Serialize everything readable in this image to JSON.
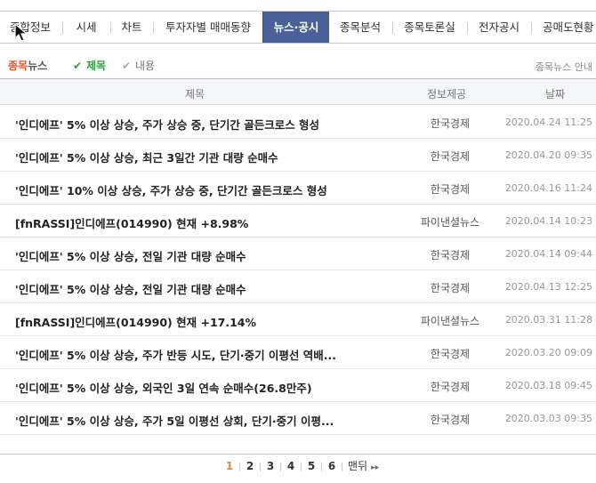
{
  "tabs": [
    {
      "label": "종합정보"
    },
    {
      "label": "시세"
    },
    {
      "label": "차트"
    },
    {
      "label": "투자자별 매매동향"
    },
    {
      "label": "뉴스·공시"
    },
    {
      "label": "종목분석"
    },
    {
      "label": "종목토론실"
    },
    {
      "label": "전자공시"
    },
    {
      "label": "공매도현황"
    }
  ],
  "subnav": {
    "title_a": "종목",
    "title_b": "뉴스",
    "active_label": "제목",
    "inactive_label": "내용",
    "guide": "종목뉴스 안내"
  },
  "table": {
    "headers": {
      "title": "제목",
      "provider": "정보제공",
      "date": "날짜"
    },
    "rows": [
      {
        "title": "'인디에프' 5% 이상 상승, 주가 상승 중, 단기간 골든크로스 형성",
        "provider": "한국경제",
        "date": "2020.04.24 11:25"
      },
      {
        "title": "'인디에프' 5% 이상 상승, 최근 3일간 기관 대량 순매수",
        "provider": "한국경제",
        "date": "2020.04.20 09:35"
      },
      {
        "title": "'인디에프' 10% 이상 상승, 주가 상승 중, 단기간 골든크로스 형성",
        "provider": "한국경제",
        "date": "2020.04.16 11:24"
      },
      {
        "title": "[fnRASSI]인디에프(014990) 현재 +8.98%",
        "provider": "파이낸셜뉴스",
        "date": "2020.04.14 10:23"
      },
      {
        "title": "'인디에프' 5% 이상 상승, 전일 기관 대량 순매수",
        "provider": "한국경제",
        "date": "2020.04.14 09:44"
      },
      {
        "title": "'인디에프' 5% 이상 상승, 전일 기관 대량 순매수",
        "provider": "한국경제",
        "date": "2020.04.13 12:25"
      },
      {
        "title": "[fnRASSI]인디에프(014990) 현재 +17.14%",
        "provider": "파이낸셜뉴스",
        "date": "2020.03.31 11:28"
      },
      {
        "title": "'인디에프' 5% 이상 상승, 주가 반등 시도, 단기·중기 이평선 역배...",
        "provider": "한국경제",
        "date": "2020.03.20 09:09"
      },
      {
        "title": "'인디에프' 5% 이상 상승, 외국인 3일 연속 순매수(26.8만주)",
        "provider": "한국경제",
        "date": "2020.03.18 09:45"
      },
      {
        "title": "'인디에프' 5% 이상 상승, 주가 5일 이평선 상회, 단기·중기 이평...",
        "provider": "한국경제",
        "date": "2020.03.03 09:35"
      }
    ]
  },
  "pagination": {
    "pages": [
      "1",
      "2",
      "3",
      "4",
      "5",
      "6"
    ],
    "current": "1",
    "last_label": "맨뒤"
  },
  "colors": {
    "active_tab": "#48619b",
    "accent_orange": "#d8582c",
    "accent_green": "#2c9a3f"
  },
  "icons": {
    "check": "check-icon",
    "cursor": "mouse-cursor-icon",
    "last": "double-chevron-right-icon"
  }
}
